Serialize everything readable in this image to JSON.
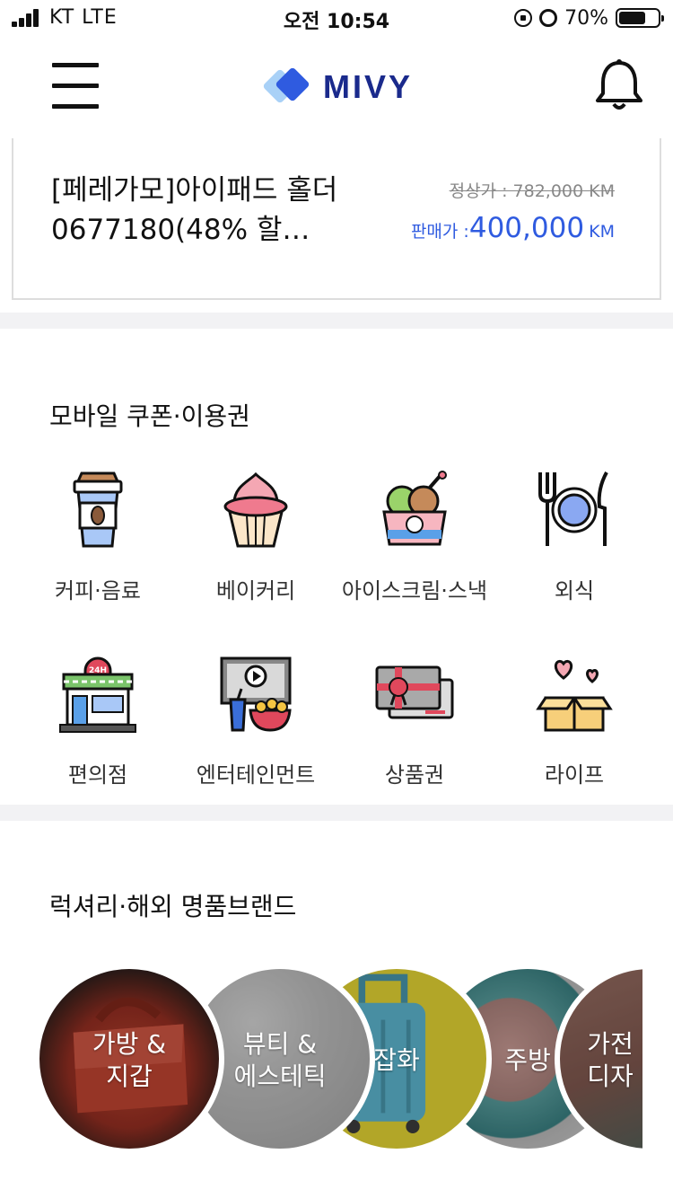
{
  "status": {
    "carrier": "KT   LTE",
    "time": "오전 10:54",
    "battery": "70%",
    "battery_level": 0.7
  },
  "header": {
    "logo_text": "MIVY",
    "colors": {
      "logo_dark": "#1a2a8c",
      "logo_light": "#9fc8f5"
    }
  },
  "product": {
    "title": "[페레가모]아이패드 홀더 0677180(48% 할…",
    "original_price": "정상가 : 782,000 KM",
    "sale_label": "판매가 :",
    "sale_value": "400,000",
    "sale_unit": "KM",
    "accent": "#2f5be0"
  },
  "coupons": {
    "title": "모바일 쿠폰·이용권",
    "items": [
      {
        "label": "커피·음료",
        "icon": "coffee-cup-icon"
      },
      {
        "label": "베이커리",
        "icon": "cupcake-icon"
      },
      {
        "label": "아이스크림·스낵",
        "icon": "ice-cream-icon"
      },
      {
        "label": "외식",
        "icon": "dining-plate-icon"
      },
      {
        "label": "편의점",
        "icon": "convenience-store-icon"
      },
      {
        "label": "엔터테인먼트",
        "icon": "entertainment-icon"
      },
      {
        "label": "상품권",
        "icon": "gift-card-icon"
      },
      {
        "label": "라이프",
        "icon": "gift-box-hearts-icon"
      }
    ]
  },
  "brands": {
    "title": "럭셔리·해외 명품브랜드",
    "items": [
      {
        "label_line1": "가방 &",
        "label_line2": "지갑"
      },
      {
        "label_line1": "뷰티 &",
        "label_line2": "에스테틱"
      },
      {
        "label_line1": "잡화",
        "label_line2": ""
      },
      {
        "label_line1": "주방",
        "label_line2": ""
      },
      {
        "label_line1": "가전",
        "label_line2": "디자"
      }
    ]
  }
}
